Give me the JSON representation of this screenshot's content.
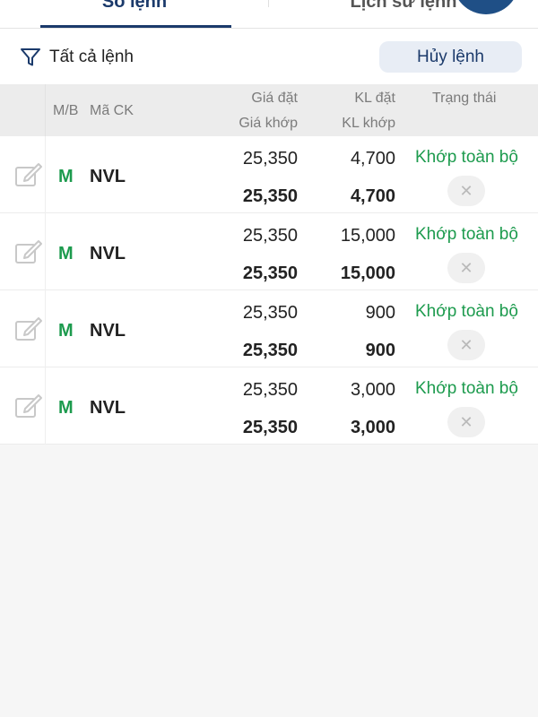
{
  "tabs": [
    {
      "label": "Sổ lệnh"
    },
    {
      "label": "Lịch sử lệnh"
    }
  ],
  "toolbar": {
    "filter_label": "Tất cả lệnh",
    "cancel_label": "Hủy lệnh"
  },
  "table": {
    "headers": {
      "side": "M/B",
      "code": "Mã CK",
      "order_price": "Giá đặt",
      "match_price": "Giá khớp",
      "order_volume": "KL đặt",
      "match_volume": "KL khớp",
      "status": "Trạng thái"
    },
    "rows": [
      {
        "side": "M",
        "code": "NVL",
        "order_price": "25,350",
        "match_price": "25,350",
        "order_volume": "4,700",
        "match_volume": "4,700",
        "status": "Khớp toàn bộ"
      },
      {
        "side": "M",
        "code": "NVL",
        "order_price": "25,350",
        "match_price": "25,350",
        "order_volume": "15,000",
        "match_volume": "15,000",
        "status": "Khớp toàn bộ"
      },
      {
        "side": "M",
        "code": "NVL",
        "order_price": "25,350",
        "match_price": "25,350",
        "order_volume": "900",
        "match_volume": "900",
        "status": "Khớp toàn bộ"
      },
      {
        "side": "M",
        "code": "NVL",
        "order_price": "25,350",
        "match_price": "25,350",
        "order_volume": "3,000",
        "match_volume": "3,000",
        "status": "Khớp toàn bộ"
      }
    ]
  },
  "icons": {
    "filter": "filter-icon",
    "edit": "edit-icon",
    "cancel_order": "close-icon"
  },
  "colors": {
    "primary": "#1b3a6b",
    "buy": "#1d9b4e",
    "status_matched": "#1d9b4e",
    "cancel_button_bg": "#e8edf5"
  }
}
